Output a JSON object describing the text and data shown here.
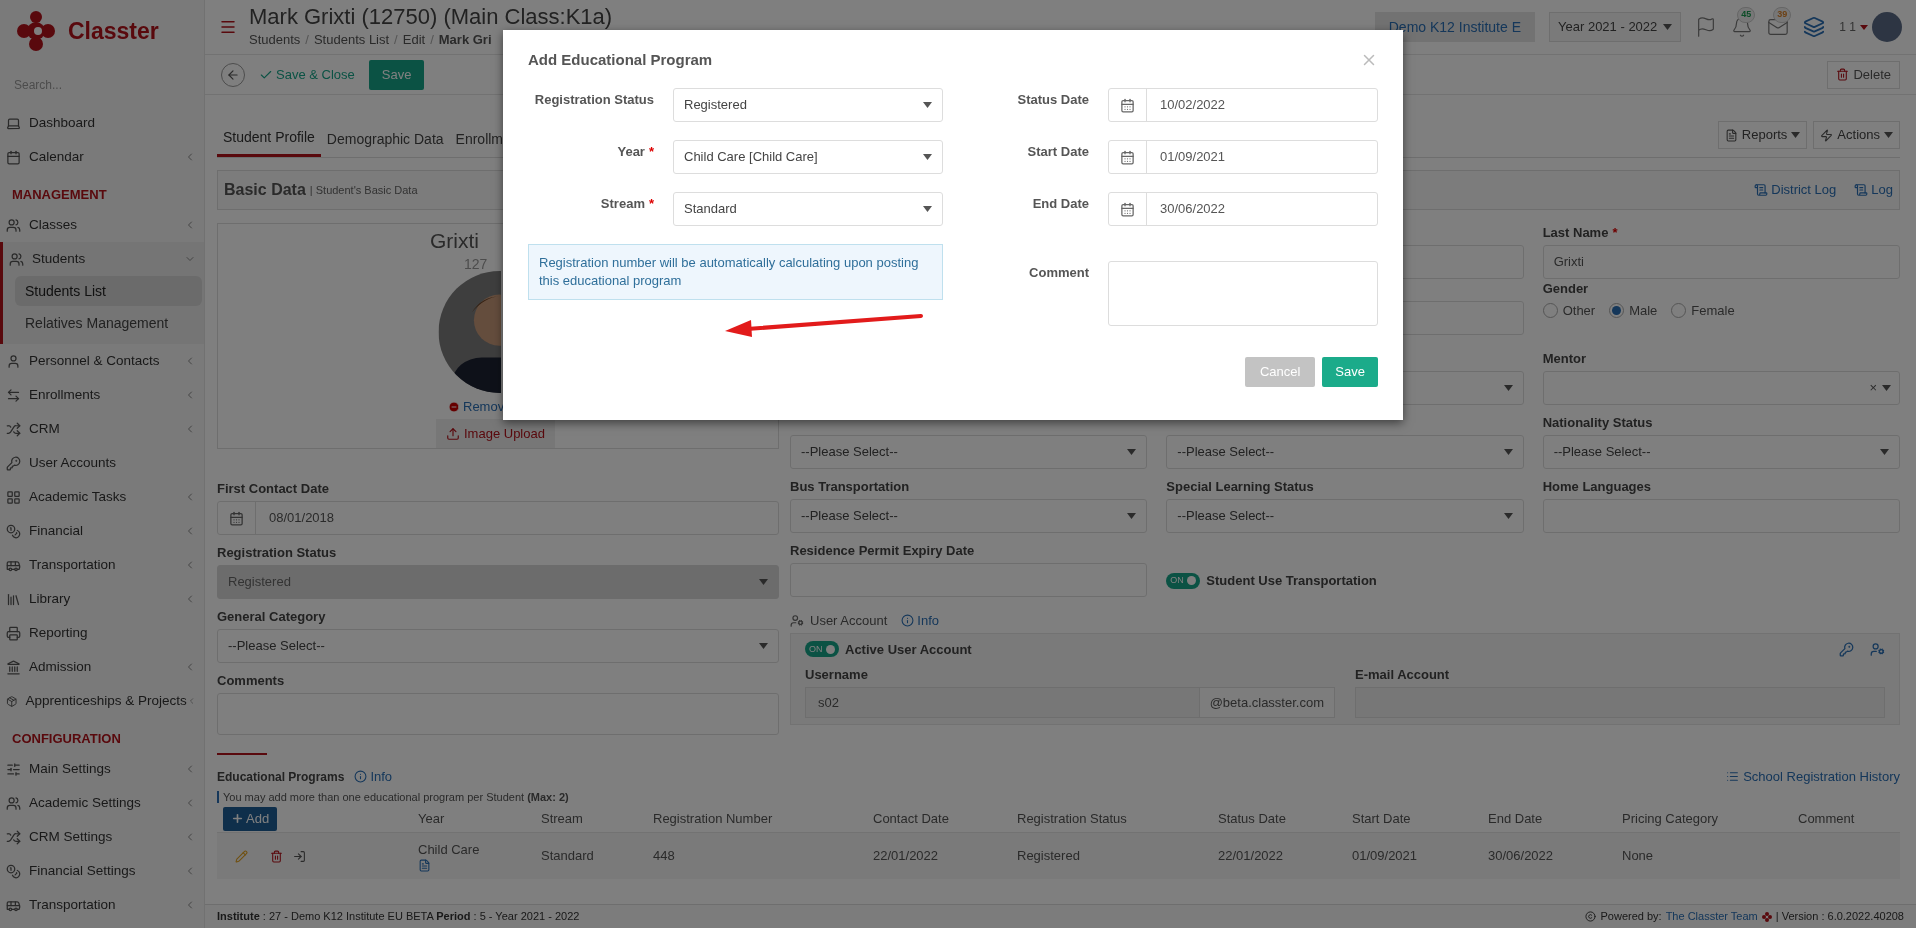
{
  "sidebar": {
    "brand": "Classter",
    "search_placeholder": "Search...",
    "items": [
      {
        "kind": "link",
        "label": "Dashboard"
      },
      {
        "kind": "group",
        "label": "Calendar",
        "expanded": false
      },
      {
        "kind": "section",
        "label": "MANAGEMENT"
      },
      {
        "kind": "group",
        "label": "Classes",
        "expanded": false
      },
      {
        "kind": "group",
        "label": "Students",
        "expanded": true,
        "children": [
          {
            "label": "Students List",
            "selected": true
          },
          {
            "label": "Relatives Management",
            "selected": false
          }
        ]
      },
      {
        "kind": "group",
        "label": "Personnel & Contacts",
        "expanded": false
      },
      {
        "kind": "group",
        "label": "Enrollments",
        "expanded": false
      },
      {
        "kind": "group",
        "label": "CRM",
        "expanded": false
      },
      {
        "kind": "link",
        "label": "User Accounts"
      },
      {
        "kind": "group",
        "label": "Academic Tasks",
        "expanded": false
      },
      {
        "kind": "group",
        "label": "Financial",
        "expanded": false
      },
      {
        "kind": "group",
        "label": "Transportation",
        "expanded": false
      },
      {
        "kind": "group",
        "label": "Library",
        "expanded": false
      },
      {
        "kind": "link",
        "label": "Reporting"
      },
      {
        "kind": "group",
        "label": "Admission",
        "expanded": false
      },
      {
        "kind": "group",
        "label": "Apprenticeships & Projects",
        "expanded": false
      },
      {
        "kind": "section",
        "label": "CONFIGURATION"
      },
      {
        "kind": "group",
        "label": "Main Settings",
        "expanded": false
      },
      {
        "kind": "group",
        "label": "Academic Settings",
        "expanded": false
      },
      {
        "kind": "group",
        "label": "CRM Settings",
        "expanded": false
      },
      {
        "kind": "group",
        "label": "Financial Settings",
        "expanded": false
      },
      {
        "kind": "group",
        "label": "Transportation",
        "expanded": false
      }
    ]
  },
  "header": {
    "title": "Mark Grixti (12750) (Main Class:K1a)",
    "breadcrumbs": [
      "Students",
      "Students List",
      "Edit",
      "Mark Gri"
    ],
    "breadcrumb_separator": "/",
    "institute": "Demo K12 Institute E",
    "year": "Year 2021 - 2022",
    "notifications": "45",
    "messages": "39",
    "user": "1 1"
  },
  "toolbar": {
    "save_close": "Save & Close",
    "save": "Save",
    "delete": "Delete"
  },
  "tabs": [
    {
      "label": "Student Profile",
      "selected": true
    },
    {
      "label": "Demographic Data",
      "selected": false
    },
    {
      "label": "Enrollm",
      "selected": false
    }
  ],
  "tab_actions": [
    "Reports",
    "Actions"
  ],
  "section": {
    "title": "Basic Data",
    "subtitle": "| Student's Basic Data",
    "links": [
      "District Log",
      "Log"
    ]
  },
  "profile": {
    "name": "Grixti",
    "id": "127",
    "remove": "Remov",
    "upload": "Image Upload"
  },
  "left_fields": [
    {
      "label": "First Contact Date",
      "kind": "date",
      "value": "08/01/2018"
    },
    {
      "label": "Registration Status",
      "kind": "select",
      "value": "Registered",
      "disabled": true
    },
    {
      "label": "General Category",
      "kind": "select",
      "value": "--Please Select--",
      "disabled": false
    },
    {
      "label": "Comments",
      "kind": "textarea"
    }
  ],
  "last_name": {
    "label": "Last Name",
    "required_mark": "*",
    "value": "Grixti"
  },
  "gender": {
    "label": "Gender",
    "options": [
      {
        "label": "Other",
        "selected": false
      },
      {
        "label": "Male",
        "selected": true
      },
      {
        "label": "Female",
        "selected": false
      }
    ]
  },
  "mentor": {
    "label": "Mentor",
    "clear": "×"
  },
  "unlabeled_selects": [
    "--Please Select--",
    "--Please Select--"
  ],
  "nationality_status": {
    "label": "Nationality Status",
    "value": "--Please Select--"
  },
  "row_e": [
    {
      "label": "Bus Transportation",
      "kind": "select",
      "value": "--Please Select--"
    },
    {
      "label": "Special Learning Status",
      "kind": "select",
      "value": "--Please Select--"
    },
    {
      "label": "Home Languages",
      "kind": "text"
    }
  ],
  "residence_permit": {
    "label": "Residence Permit Expiry Date"
  },
  "transport_toggle": {
    "on": true,
    "text": "ON",
    "label": "Student Use Transportation"
  },
  "user_account": {
    "title": "User Account",
    "info": "Info",
    "toggle": {
      "on": true,
      "text": "ON",
      "label": "Active User Account"
    },
    "username_label": "Username",
    "username": "s02",
    "domain": "@beta.classter.com",
    "email_label": "E-mail Account"
  },
  "programs": {
    "title": "Educational Programs",
    "info": "Info",
    "note": "You may add more than one educational program per Student **(Max: 2)**",
    "history": "School Registration History",
    "add": "Add",
    "columns": [
      "Year",
      "Stream",
      "Registration Number",
      "Contact Date",
      "Registration Status",
      "Status Date",
      "Start Date",
      "End Date",
      "Pricing Category",
      "Comment"
    ],
    "rows": [
      {
        "cells": [
          "Child Care",
          "Standard",
          "448",
          "22/01/2022",
          "Registered",
          "22/01/2022",
          "01/09/2021",
          "30/06/2022",
          "None"
        ]
      }
    ]
  },
  "footer": {
    "left": "**Institute** : 27 - Demo K12 Institute EU BETA **Period** : 5 - Year 2021 - 2022",
    "powered": "Powered by:",
    "team": "The Classter Team",
    "version": "| Version : 6.0.2022.40208"
  },
  "modal": {
    "title": "Add Educational Program",
    "left": [
      {
        "label": "Registration Status",
        "value": "Registered"
      },
      {
        "label": "Year",
        "required_mark": "*",
        "value": "Child Care [Child Care]"
      },
      {
        "label": "Stream",
        "required_mark": "*",
        "value": "Standard"
      }
    ],
    "info": "Registration number will be automatically calculating upon posting this educational program",
    "right": [
      {
        "label": "Status Date",
        "value": "10/02/2022"
      },
      {
        "label": "Start Date",
        "value": "01/09/2021"
      },
      {
        "label": "End Date",
        "value": "30/06/2022"
      }
    ],
    "comment_label": "Comment",
    "buttons": [
      {
        "label": "Cancel",
        "kind": "secondary"
      },
      {
        "label": "Save",
        "kind": "primary"
      }
    ]
  }
}
